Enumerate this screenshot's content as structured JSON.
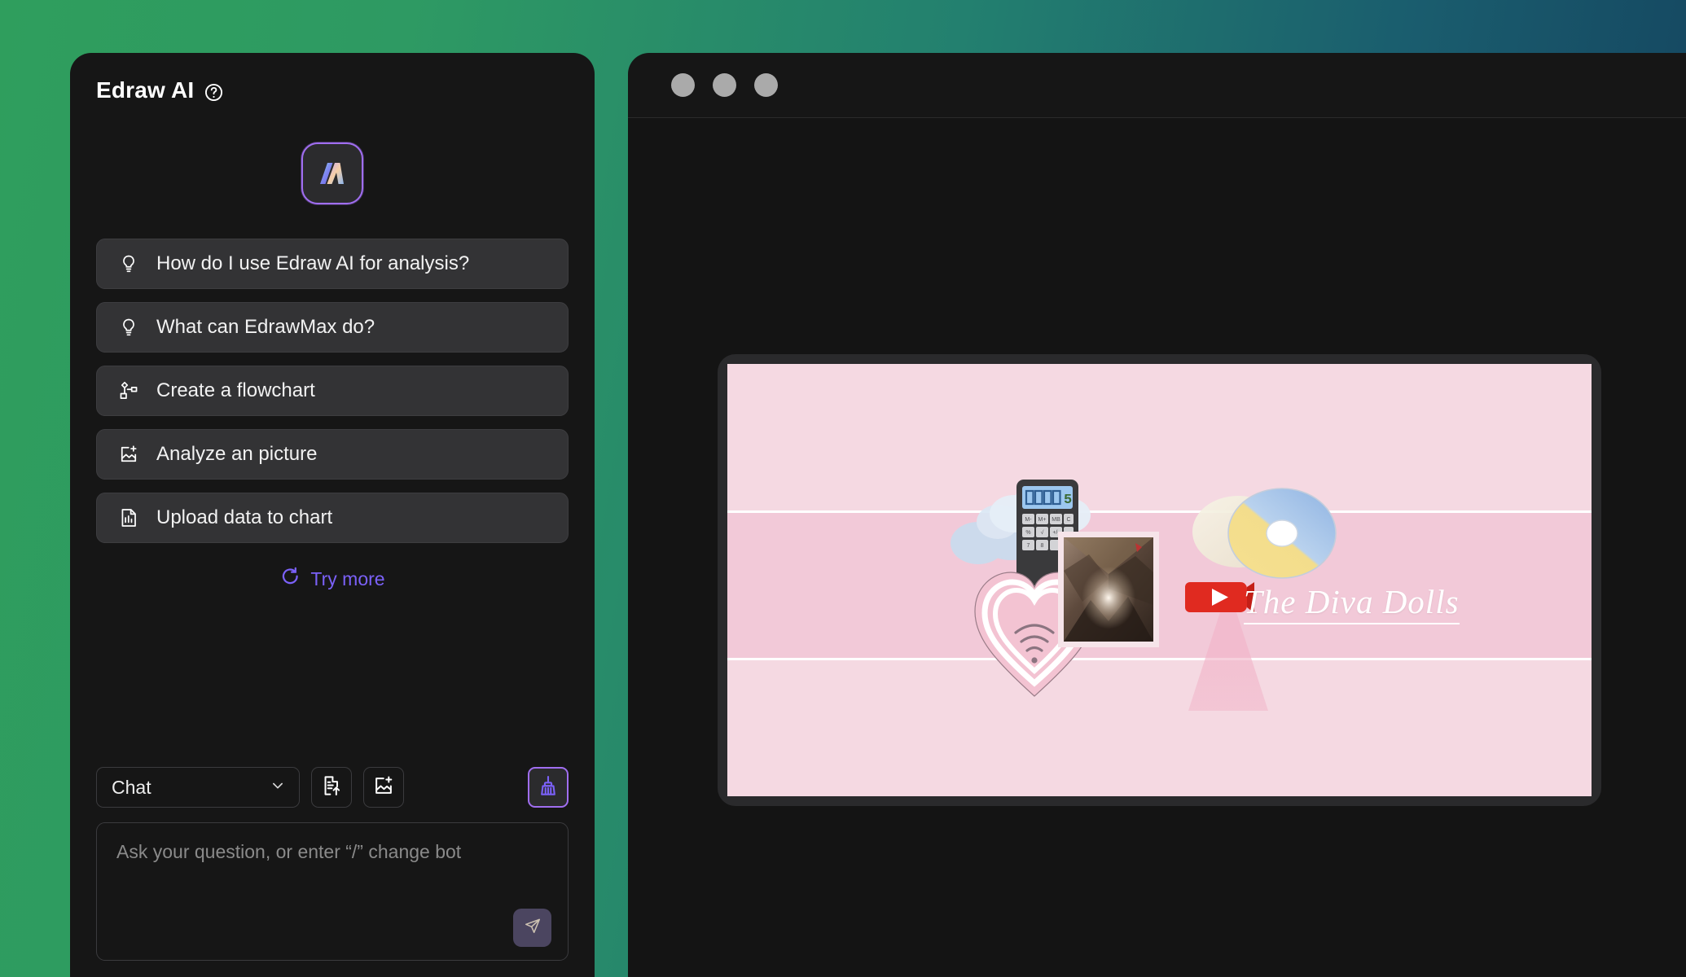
{
  "sidebar": {
    "title": "Edraw AI",
    "help_icon": "question-circle-icon",
    "logo_icon": "edraw-ai-logo-icon",
    "suggestions": [
      {
        "icon": "lightbulb-icon",
        "label": "How do I use Edraw AI for analysis?"
      },
      {
        "icon": "lightbulb-icon",
        "label": "What can EdrawMax do?"
      },
      {
        "icon": "flowchart-icon",
        "label": "Create a flowchart"
      },
      {
        "icon": "image-plus-icon",
        "label": "Analyze an picture"
      },
      {
        "icon": "chart-file-icon",
        "label": "Upload data to chart"
      }
    ],
    "try_more": {
      "label": "Try more",
      "icon": "refresh-icon",
      "color": "#7b61f8"
    },
    "composer": {
      "mode": {
        "value": "Chat",
        "chevron_icon": "chevron-down-icon"
      },
      "tools": [
        {
          "icon": "document-upload-icon",
          "name": "upload-document"
        },
        {
          "icon": "image-plus-icon",
          "name": "upload-image"
        }
      ],
      "clean_button": {
        "icon": "broom-icon",
        "accent": "#a06ef0"
      },
      "input_placeholder": "Ask your question, or enter  “/” change bot",
      "send_button": {
        "icon": "send-icon"
      }
    }
  },
  "app_window": {
    "titlebar": {
      "dots": [
        "window-dot-1",
        "window-dot-2",
        "window-dot-3"
      ]
    },
    "canvas": {
      "background_color": "#f5d9e2",
      "band_color": "#f2c9d8",
      "band_line_color": "#ffffff",
      "title_text": "The Diva Dolls",
      "collage_items": [
        "cloud-sticker",
        "cloud-sticker",
        "calculator-sticker",
        "compact-disc-sticker",
        "wifi-heart-sticker",
        "photo-polaroid-sticker",
        "youtube-logo-sticker",
        "light-cone-sticker"
      ],
      "calculator_display": "00005",
      "calculator_keys": [
        "M-",
        "M+",
        "MB",
        "C",
        "%",
        "√",
        "+/-",
        "7",
        "8"
      ]
    }
  },
  "theme": {
    "desktop_gradient_start": "#2f9e5d",
    "desktop_gradient_end": "#133f5c",
    "panel_background": "#161616",
    "suggestion_background": "#333335",
    "accent_purple": "#7b61f8"
  }
}
